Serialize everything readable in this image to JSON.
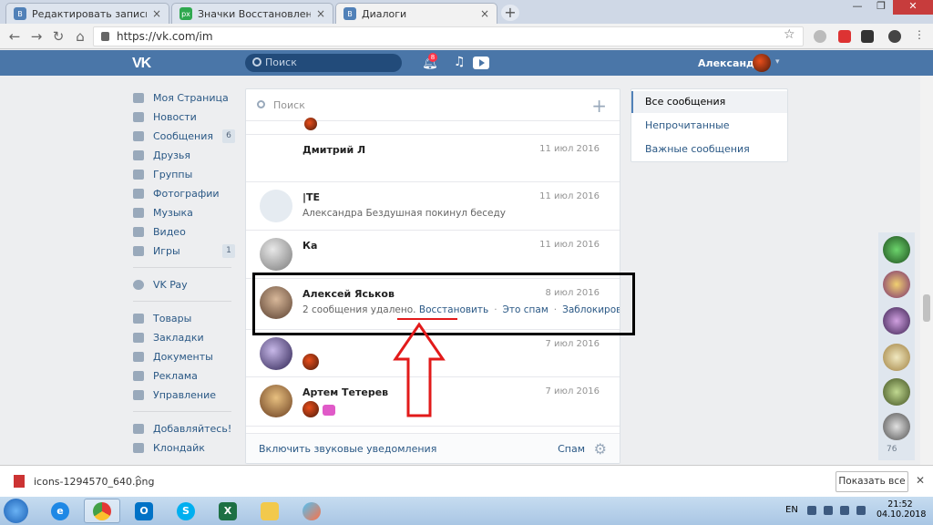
{
  "browser": {
    "tabs": [
      {
        "title": "Редактировать запись ‹ All Vk m",
        "icon": "vk-favicon",
        "color": "#5181b8"
      },
      {
        "title": "Значки Восстановление Иконк",
        "icon": "px-favicon",
        "color": "#2fa84f"
      },
      {
        "title": "Диалоги",
        "icon": "vk-favicon",
        "color": "#5181b8"
      }
    ],
    "url": "https://vk.com/im",
    "new_tab_label": "+"
  },
  "vk": {
    "logo": "VK",
    "search_placeholder": "Поиск",
    "notifications_count": "8",
    "username": "Александра",
    "accent_color": "#4a76a8"
  },
  "menu": {
    "items": [
      {
        "label": "Моя Страница",
        "icon": "home-icon"
      },
      {
        "label": "Новости",
        "icon": "news-icon"
      },
      {
        "label": "Сообщения",
        "icon": "messages-icon",
        "count": "6"
      },
      {
        "label": "Друзья",
        "icon": "friends-icon"
      },
      {
        "label": "Группы",
        "icon": "groups-icon"
      },
      {
        "label": "Фотографии",
        "icon": "camera-icon"
      },
      {
        "label": "Музыка",
        "icon": "music-icon"
      },
      {
        "label": "Видео",
        "icon": "video-icon"
      },
      {
        "label": "Игры",
        "icon": "games-icon",
        "count": "1"
      },
      {
        "label": "VK Pay",
        "icon": "vkpay-icon"
      },
      {
        "label": "Товары",
        "icon": "goods-icon"
      },
      {
        "label": "Закладки",
        "icon": "star-icon"
      },
      {
        "label": "Документы",
        "icon": "documents-icon"
      },
      {
        "label": "Реклама",
        "icon": "ads-icon"
      },
      {
        "label": "Управление",
        "icon": "gamepad-icon"
      },
      {
        "label": "Добавляйтесь!",
        "icon": "apps-icon"
      },
      {
        "label": "Клондайк",
        "icon": "app-icon"
      }
    ]
  },
  "dialogs": {
    "search_placeholder": "Поиск",
    "rows": [
      {
        "name": "Дмитрий Л",
        "date": "11 июл 2016",
        "message": ""
      },
      {
        "name": "|TE",
        "date": "11 июл 2016",
        "message": "Александра Бездушная покинул беседу"
      },
      {
        "name": "Ка",
        "date": "11 июл 2016",
        "message": ""
      },
      {
        "name": "Алексей Яськов",
        "date": "8 июл 2016",
        "message": "2 сообщения удалено.",
        "restore": "Восстановить",
        "spam": "Это спам",
        "block": "Заблокировать"
      },
      {
        "name": "",
        "date": "7 июл 2016",
        "message": ""
      },
      {
        "name": "Артем Тетерев",
        "date": "7 июл 2016",
        "message": ""
      }
    ],
    "footer_sound": "Включить звуковые уведомления",
    "footer_spam": "Спам"
  },
  "filters": {
    "items": [
      "Все сообщения",
      "Непрочитанные",
      "Важные сообщения"
    ]
  },
  "friends_count": "76",
  "download": {
    "filename": "icons-1294570_640.png",
    "show_all": "Показать все"
  },
  "taskbar": {
    "lang": "EN",
    "time": "21:52",
    "date": "04.10.2018"
  }
}
